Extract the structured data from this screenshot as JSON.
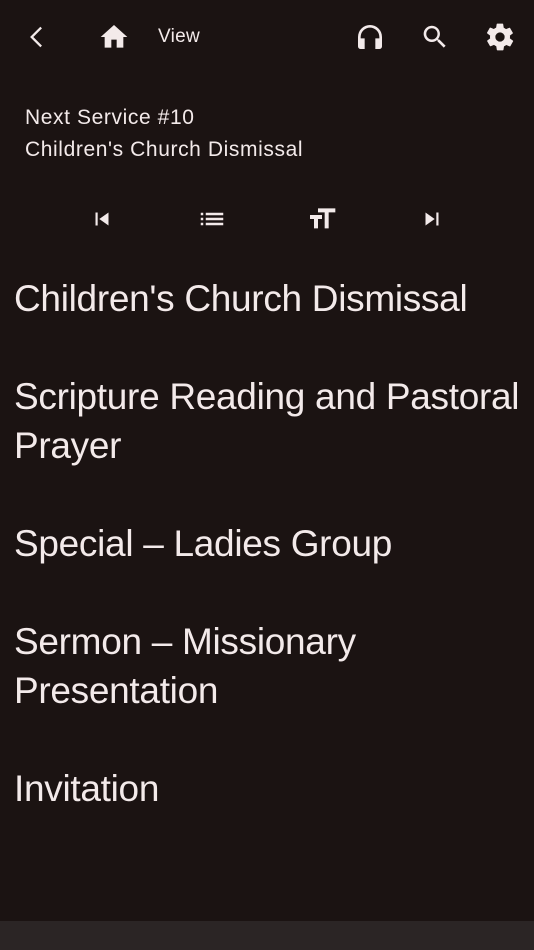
{
  "header": {
    "view_label": "View",
    "icons": [
      "back-icon",
      "home-icon",
      "headphones-icon",
      "search-icon",
      "settings-gear-icon"
    ]
  },
  "service": {
    "next_service": "Next Service #10",
    "current_item": "Children's Church Dismissal"
  },
  "controls": {
    "icons": [
      "skip-previous-icon",
      "list-icon",
      "text-size-icon",
      "skip-next-icon"
    ]
  },
  "order": {
    "items": [
      "Children's Church Dismissal",
      "Scripture Reading and Pastoral Prayer",
      "Special – Ladies Group",
      "Sermon – Missionary Presentation",
      "Invitation"
    ]
  },
  "colors": {
    "background": "#1b1312",
    "text": "#f3eaea",
    "bottom_bar": "#2b2525"
  }
}
